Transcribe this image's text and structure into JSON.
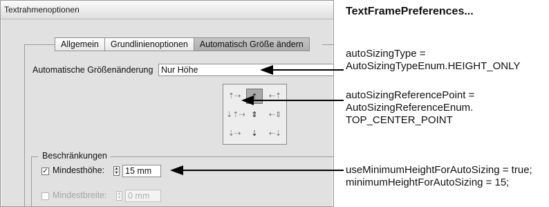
{
  "dialog": {
    "title": "Textrahmenoptionen",
    "tabs": [
      "Allgemein",
      "Grundlinienoptionen",
      "Automatisch Größe ändern"
    ],
    "active_tab": "Automatisch Größe ändern",
    "autosize_label": "Automatische Größenänderung",
    "autosize_value": "Nur Höhe",
    "reference_grid": {
      "cells": [
        "⇡⇢",
        "⇡",
        "⇠⇡",
        "⇣⇡⇢",
        "⇕",
        "⇠⇕",
        "⇣⇢",
        "⇣",
        "⇠⇣"
      ],
      "selected": "top-center"
    },
    "constraints_label": "Beschränkungen",
    "min_height": {
      "label": "Mindesthöhe:",
      "checked": true,
      "value": "15 mm",
      "check_glyph": "✓"
    },
    "min_width": {
      "label": "Mindestbreite:",
      "checked": false,
      "value": "0 mm"
    },
    "spinner_glyph_up": "▲",
    "spinner_glyph_down": "▼"
  },
  "annotations": {
    "title": "TextFramePreferences...",
    "type_line1": "autoSizingType =",
    "type_line2": "AutoSizingTypeEnum.HEIGHT_ONLY",
    "ref_line1": "autoSizingReferencePoint =",
    "ref_line2": "AutoSizingReferenceEnum.",
    "ref_line3": "TOP_CENTER_POINT",
    "min_line1": "useMinimumHeightForAutoSizing = true;",
    "min_line2": "minimumHeightForAutoSizing = 15;"
  },
  "colors": {
    "dialog_bg": "#e1e1e1",
    "active_tab": "#b4b4b4",
    "arrow": "#000000"
  }
}
